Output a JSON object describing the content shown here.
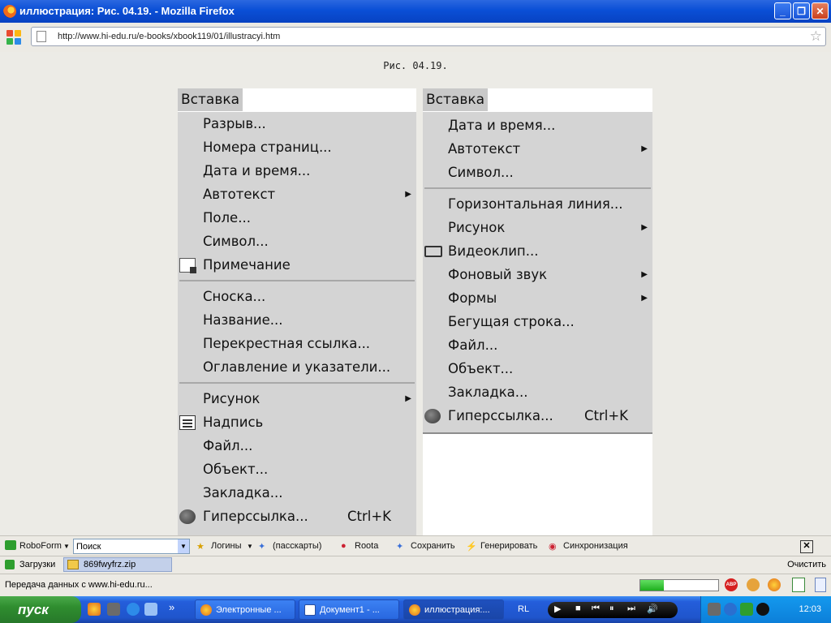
{
  "window": {
    "title": "иллюстрация: Рис. 04.19. - Mozilla Firefox",
    "min": "_",
    "max": "❐",
    "close": "✕"
  },
  "address": {
    "url": "http://www.hi-edu.ru/e-books/xbook119/01/illustracyi.htm",
    "star": "☆"
  },
  "page": {
    "caption": "Рис. 04.19.",
    "left_menu": {
      "title": "Вставка",
      "items": [
        {
          "label": "Разрыв..."
        },
        {
          "label": "Номера страниц..."
        },
        {
          "label": "Дата и время..."
        },
        {
          "label": "Автотекст",
          "submenu": true
        },
        {
          "label": "Поле..."
        },
        {
          "label": "Символ..."
        },
        {
          "label": "Примечание",
          "icon": "comment-icon"
        },
        {
          "separator": true
        },
        {
          "label": "Сноска..."
        },
        {
          "label": "Название..."
        },
        {
          "label": "Перекрестная ссылка..."
        },
        {
          "label": "Оглавление и указатели..."
        },
        {
          "separator": true
        },
        {
          "label": "Рисунок",
          "submenu": true
        },
        {
          "label": "Надпись",
          "icon": "textbox-icon"
        },
        {
          "label": "Файл..."
        },
        {
          "label": "Объект..."
        },
        {
          "label": "Закладка..."
        },
        {
          "label": "Гиперссылка...",
          "shortcut": "Ctrl+K",
          "icon": "hyperlink-icon"
        }
      ]
    },
    "right_menu": {
      "title": "Вставка",
      "items": [
        {
          "label": "Дата и время..."
        },
        {
          "label": "Автотекст",
          "submenu": true
        },
        {
          "label": "Символ..."
        },
        {
          "separator": true
        },
        {
          "label": "Горизонтальная линия..."
        },
        {
          "label": "Рисунок",
          "submenu": true
        },
        {
          "label": "Видеоклип...",
          "icon": "video-icon"
        },
        {
          "label": "Фоновый звук",
          "submenu": true
        },
        {
          "label": "Формы",
          "submenu": true
        },
        {
          "label": "Бегущая строка..."
        },
        {
          "label": "Файл..."
        },
        {
          "label": "Объект..."
        },
        {
          "label": "Закладка..."
        },
        {
          "label": "Гиперссылка...",
          "shortcut": "Ctrl+K",
          "icon": "hyperlink-icon"
        }
      ]
    }
  },
  "toolbar": {
    "roboform": "RoboForm",
    "search_value": "Поиск",
    "logins": "Логины",
    "passcards": "(пасскарты)",
    "roota": "Roota",
    "save": "Сохранить",
    "generate": "Генерировать",
    "sync": "Синхронизация",
    "close": "✕"
  },
  "downloads": {
    "label": "Загрузки",
    "file": "869fwyfrz.zip",
    "clear": "Очистить"
  },
  "status": {
    "text": "Передача данных с www.hi-edu.ru...",
    "progress": 0.3
  },
  "taskbar": {
    "start": "пуск",
    "tasks": [
      {
        "label": "Электронные ..."
      },
      {
        "label": "Документ1 - ..."
      },
      {
        "label": "иллюстрация:..."
      }
    ],
    "quicklaunch_more": "»",
    "lang": "RL",
    "clock": "12:03"
  }
}
